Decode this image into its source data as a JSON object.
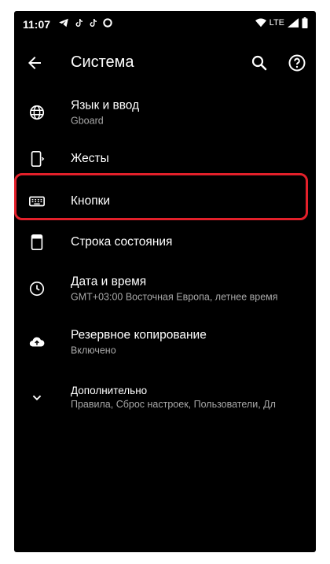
{
  "status": {
    "time": "11:07",
    "network": "LTE"
  },
  "appbar": {
    "title": "Система"
  },
  "items": [
    {
      "title": "Язык и ввод",
      "subtitle": "Gboard",
      "icon": "globe-icon"
    },
    {
      "title": "Жесты",
      "subtitle": "",
      "icon": "phone-gesture-icon"
    },
    {
      "title": "Кнопки",
      "subtitle": "",
      "icon": "keyboard-icon",
      "highlighted": true
    },
    {
      "title": "Строка состояния",
      "subtitle": "",
      "icon": "status-bar-icon"
    },
    {
      "title": "Дата и время",
      "subtitle": "GMT+03:00 Восточная Европа, летнее время",
      "icon": "clock-icon"
    },
    {
      "title": "Резервное копирование",
      "subtitle": "Включено",
      "icon": "cloud-backup-icon"
    },
    {
      "title": "Дополнительно",
      "subtitle": "Правила, Сброс настроек, Пользователи, Дл",
      "icon": "chevron-down-icon"
    }
  ],
  "colors": {
    "background": "#000000",
    "text_primary": "#ffffff",
    "text_secondary": "#a8a8a8",
    "highlight": "#e3202a"
  }
}
